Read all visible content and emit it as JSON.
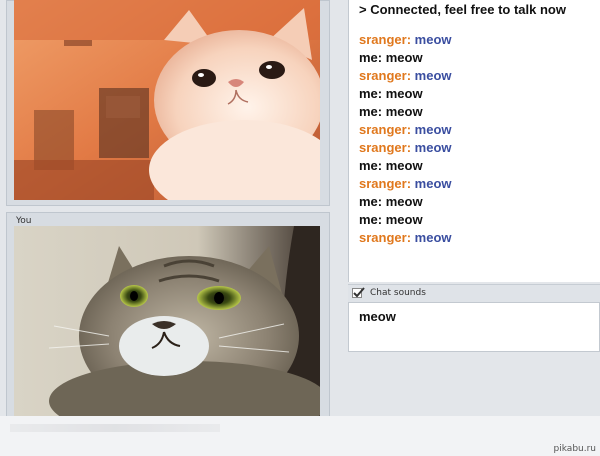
{
  "stranger_video": {
    "label": ""
  },
  "self_video": {
    "label": "You"
  },
  "chat": {
    "status": "> Connected, feel free to talk now",
    "messages": [
      {
        "who": "sranger:",
        "text": "meow",
        "kind": "stranger"
      },
      {
        "who": "me:",
        "text": "meow",
        "kind": "me"
      },
      {
        "who": "sranger:",
        "text": "meow",
        "kind": "stranger"
      },
      {
        "who": "me:",
        "text": "meow",
        "kind": "me"
      },
      {
        "who": "me:",
        "text": "meow",
        "kind": "me"
      },
      {
        "who": "sranger:",
        "text": "meow",
        "kind": "stranger"
      },
      {
        "who": "sranger:",
        "text": "meow",
        "kind": "stranger"
      },
      {
        "who": "me:",
        "text": "meow",
        "kind": "me"
      },
      {
        "who": "sranger:",
        "text": "meow",
        "kind": "stranger"
      },
      {
        "who": "me:",
        "text": "meow",
        "kind": "me"
      },
      {
        "who": "me:",
        "text": "meow",
        "kind": "me"
      },
      {
        "who": "sranger:",
        "text": "meow",
        "kind": "stranger"
      }
    ]
  },
  "sounds": {
    "label": "Chat sounds",
    "checked": true
  },
  "input": {
    "value": "meow"
  },
  "watermark": {
    "text": "pikabu.ru"
  },
  "colors": {
    "stranger_name": "#e0781d",
    "stranger_text": "#3a4ea0",
    "me": "#111111"
  }
}
